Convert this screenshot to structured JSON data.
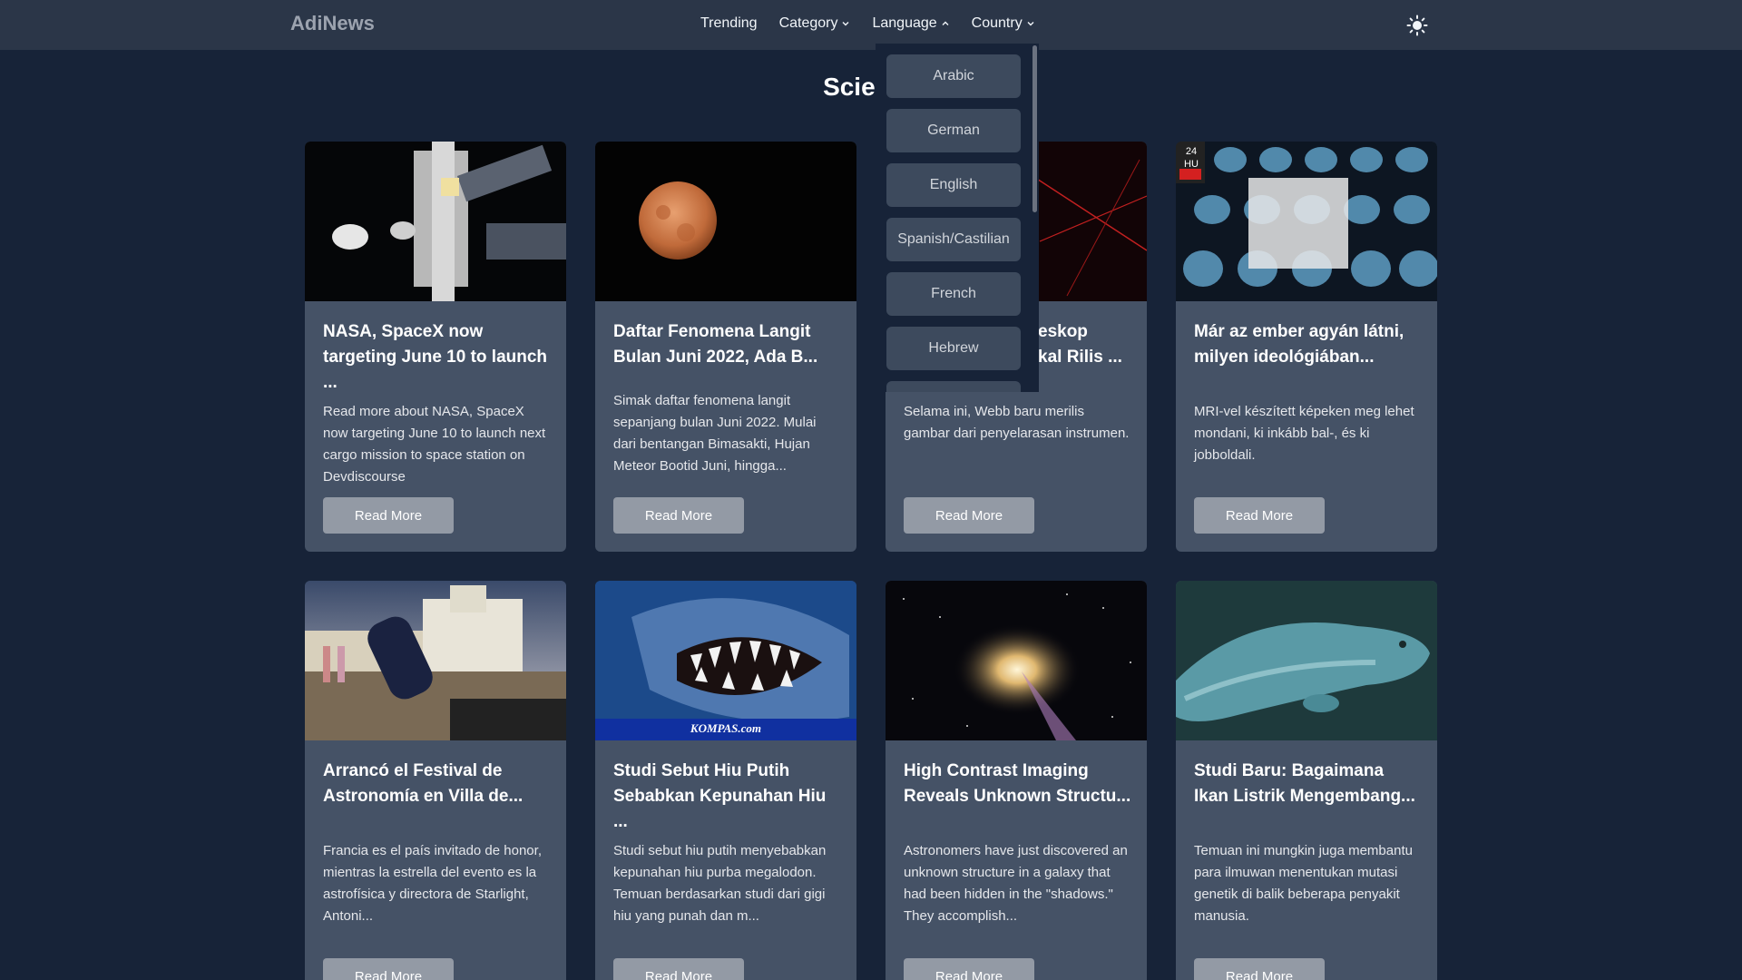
{
  "navbar": {
    "brand": "AdiNews",
    "links": [
      "Trending",
      "Category",
      "Language",
      "Country"
    ],
    "theme_icon": "sun-icon"
  },
  "heading": "Science",
  "language_menu": {
    "options": [
      "Arabic",
      "German",
      "English",
      "Spanish/Castilian",
      "French",
      "Hebrew"
    ]
  },
  "cards": [
    {
      "title": "NASA, SpaceX now targeting June 10 to launch ...",
      "description": "Read more about NASA, SpaceX now targeting June 10 to launch next cargo mission to space station on Devdiscourse",
      "button": "Read More"
    },
    {
      "title": "Daftar Fenomena Langit Bulan Juni 2022, Ada B...",
      "description": "Simak daftar fenomena langit sepanjang bulan Juni 2022. Mulai dari bentangan Bimasakti, Hujan Meteor Bootid Juni, hingga...",
      "button": "Read More"
    },
    {
      "title_visible": "eskop",
      "title_visible_2": "kal Rilis ...",
      "description": "Selama ini, Webb baru merilis gambar dari penyelarasan instrumen.",
      "button": "Read More"
    },
    {
      "title": "Már az ember agyán látni, milyen ideológiában...",
      "description": "MRI-vel készített képeken meg lehet mondani, ki inkább bal-, és ki jobboldali.",
      "button": "Read More",
      "badge": "24 HU"
    },
    {
      "title": "Arrancó el Festival de Astronomía en Villa de...",
      "description": "Francia es el país invitado de honor, mientras la estrella del evento es la astrofísica y directora de Starlight, Antoni...",
      "button": "Read More"
    },
    {
      "title": "Studi Sebut Hiu Putih Sebabkan Kepunahan Hiu ...",
      "description": "Studi sebut hiu putih menyebabkan kepunahan hiu purba megalodon. Temuan berdasarkan studi dari gigi hiu yang punah dan m...",
      "button": "Read More",
      "watermark": "KOMPAS.com"
    },
    {
      "title": "High Contrast Imaging Reveals Unknown Structu...",
      "description": "Astronomers have just discovered an unknown structure in a galaxy that had been hidden in the \"shadows.\" They accomplish...",
      "button": "Read More"
    },
    {
      "title": "Studi Baru: Bagaimana Ikan Listrik Mengembang...",
      "description": "Temuan ini mungkin juga membantu para ilmuwan menentukan mutasi genetik di balik beberapa penyakit manusia.",
      "button": "Read More"
    }
  ]
}
